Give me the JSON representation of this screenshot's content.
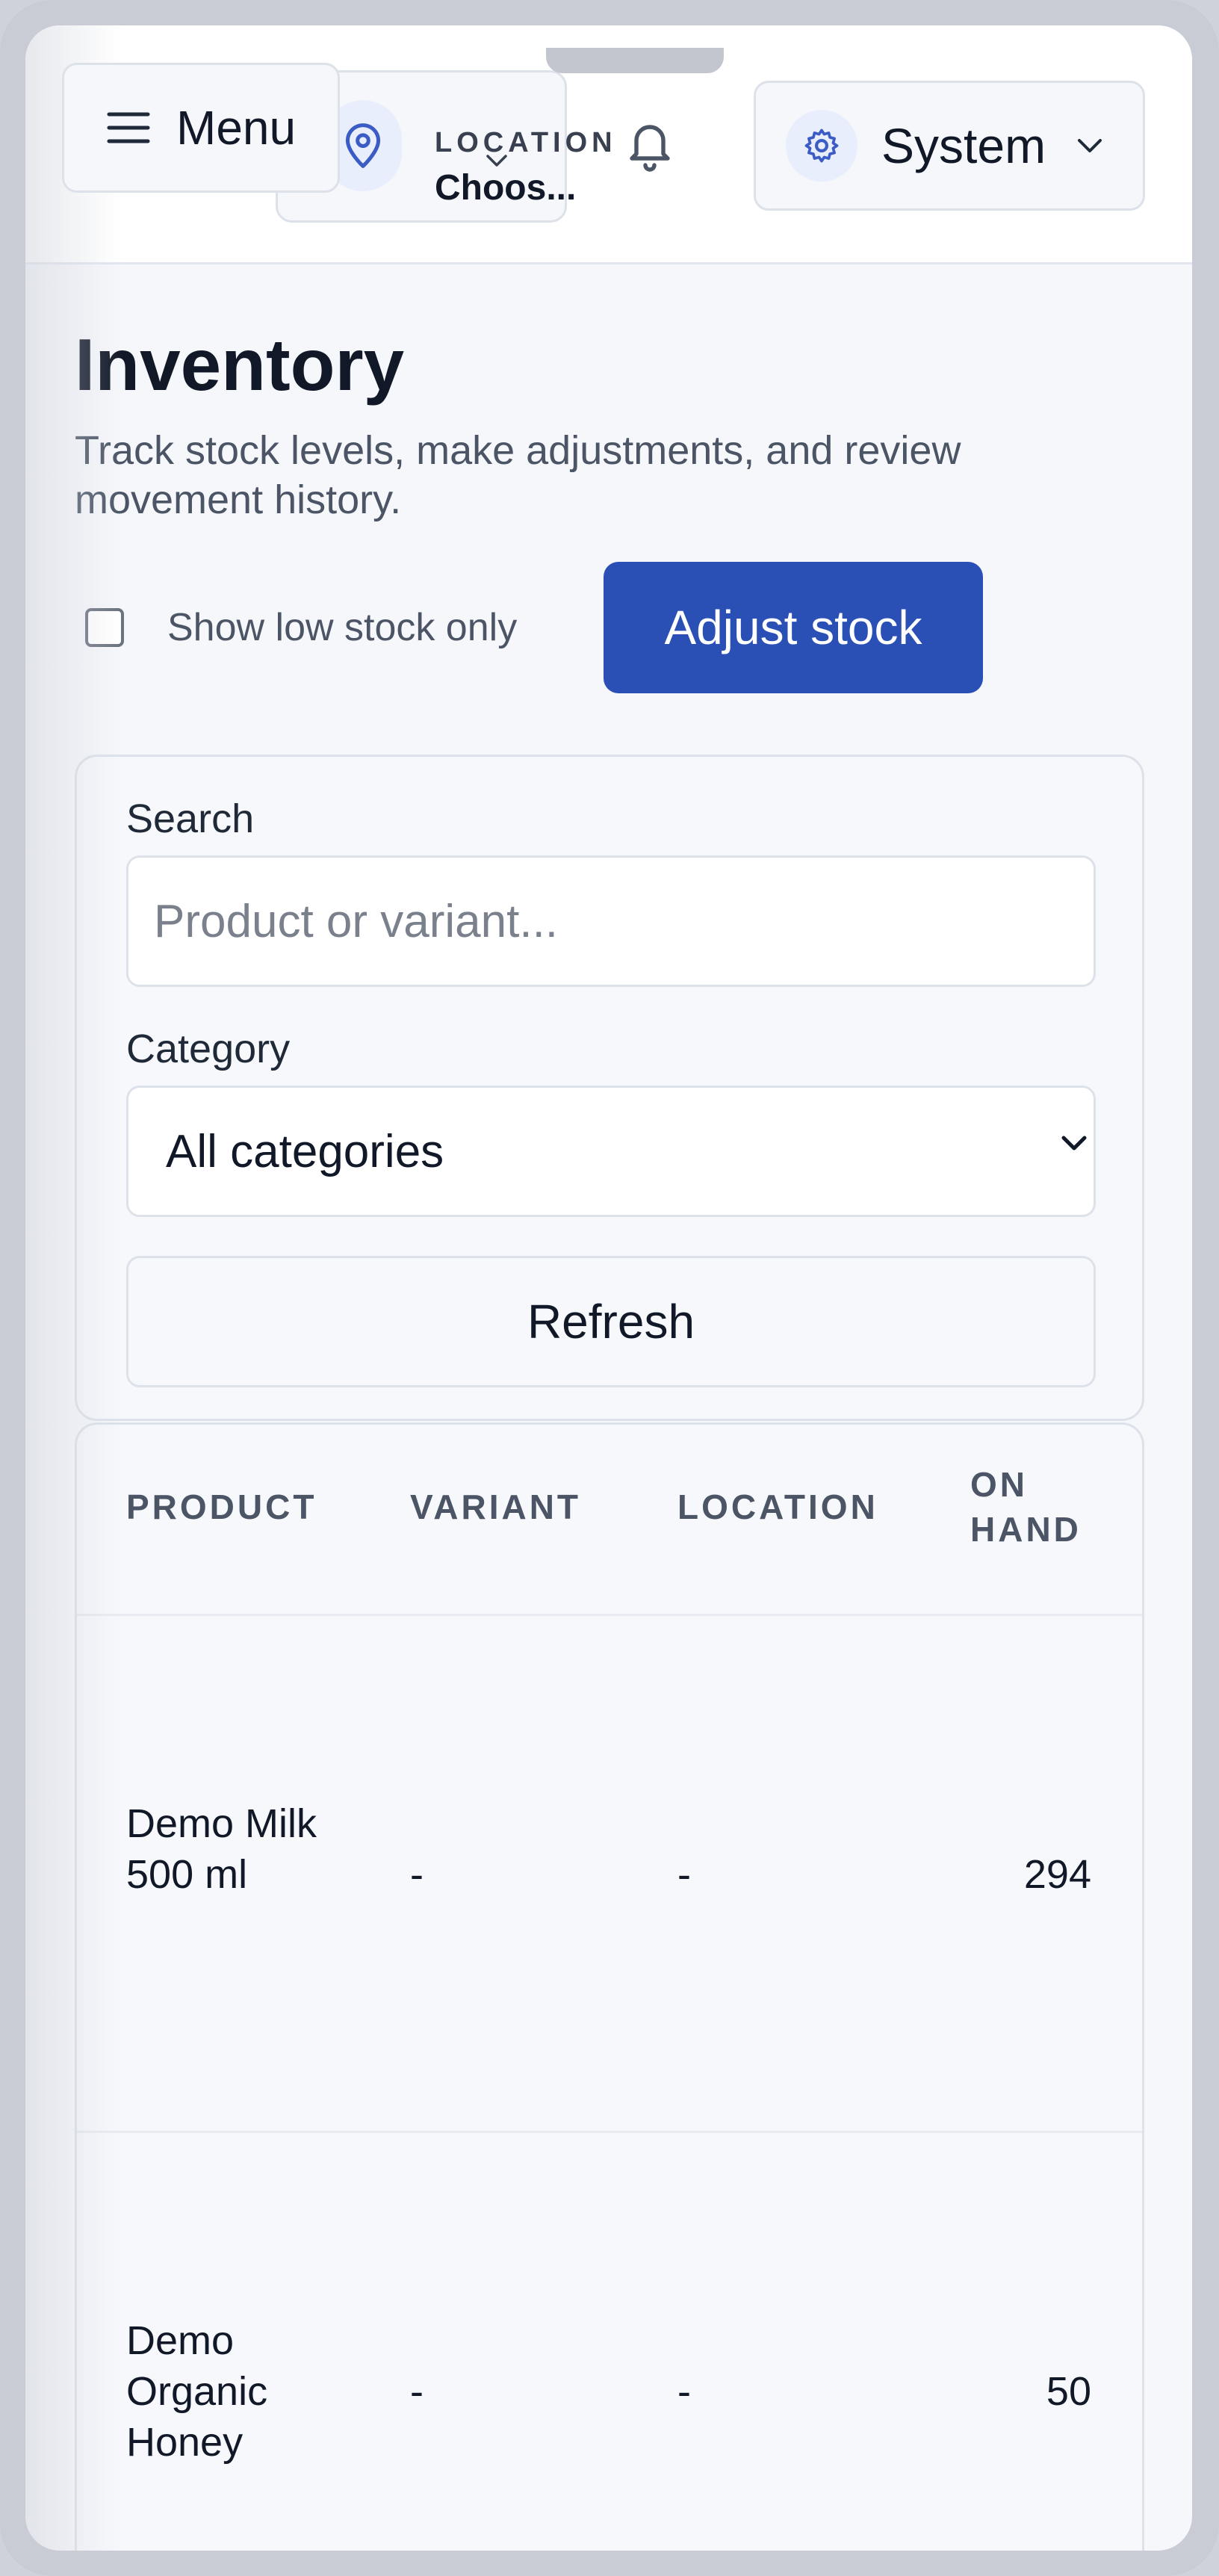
{
  "header": {
    "menu_label": "Menu",
    "location_label": "LOCATION",
    "location_value": "Choos...",
    "system_label": "System"
  },
  "page": {
    "title": "Inventory",
    "subtitle": "Track stock levels, make adjustments, and review movement history.",
    "low_stock_label": "Show low stock only",
    "low_stock_checked": false,
    "adjust_label": "Adjust stock"
  },
  "filters": {
    "search_label": "Search",
    "search_placeholder": "Product or variant...",
    "category_label": "Category",
    "category_value": "All categories",
    "refresh_label": "Refresh"
  },
  "table": {
    "columns": [
      "PRODUCT",
      "VARIANT",
      "LOCATION",
      "ON HAND"
    ],
    "rows": [
      {
        "product": "Demo Milk 500 ml",
        "variant": "-",
        "location": "-",
        "on_hand": "294"
      },
      {
        "product": "Demo Organic Honey",
        "variant": "-",
        "location": "-",
        "on_hand": "50"
      }
    ]
  },
  "colors": {
    "accent": "#2a4fb5",
    "icon_blue": "#3b5cc4",
    "page_bg": "#f6f7fb"
  },
  "icons": [
    "hamburger-icon",
    "map-pin-icon",
    "chevron-down-icon",
    "bell-icon",
    "gear-icon"
  ]
}
